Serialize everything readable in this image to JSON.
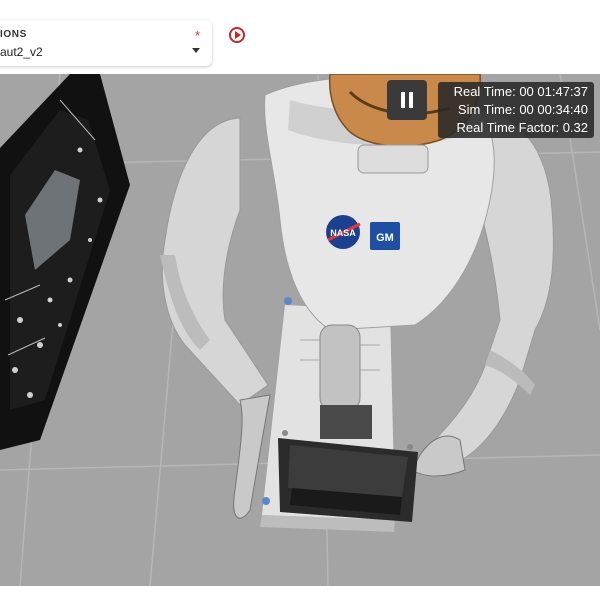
{
  "header": {
    "select_label": "IONS",
    "select_value": "aut2_v2",
    "required_mark": "*"
  },
  "controls": {
    "play_icon": "play-circle-icon",
    "pause_icon": "pause-icon"
  },
  "stats": {
    "real_time": "Real Time: 00 01:47:37",
    "sim_time": "Sim Time: 00 00:34:40",
    "rtf": "Real Time Factor: 0.32"
  },
  "robot": {
    "chest_logo_left": "NASA",
    "chest_logo_right": "GM"
  },
  "colors": {
    "accent": "#c62828",
    "floor": "#a4a4a4",
    "helmet": "#c8894a",
    "overlay": "#3a3a3a"
  }
}
